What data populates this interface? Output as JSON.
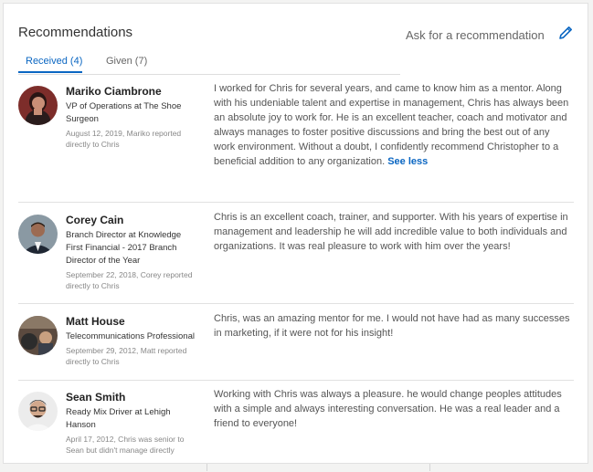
{
  "section": {
    "title": "Recommendations",
    "ask_label": "Ask for a recommendation",
    "edit_icon": "pencil-icon",
    "accent_color": "#0a66c2"
  },
  "tabs": [
    {
      "label": "Received (4)",
      "active": true
    },
    {
      "label": "Given (7)",
      "active": false
    }
  ],
  "recommendations": [
    {
      "name": "Mariko Ciambrone",
      "title": "VP of Operations at The Shoe Surgeon",
      "meta": "August 12, 2019, Mariko reported directly to Chris",
      "text": "I worked for Chris for several years, and came to know him as a mentor. Along with his undeniable talent and expertise in management, Chris has always been an absolute joy to work for. He is an excellent teacher, coach and motivator and always manages to foster positive discussions and bring the best out of any work environment. Without a doubt, I confidently recommend Christopher to a beneficial addition to any organization.",
      "see_less": "See less"
    },
    {
      "name": "Corey Cain",
      "title": "Branch Director at Knowledge First Financial - 2017 Branch Director of the Year",
      "meta": "September 22, 2018, Corey reported directly to Chris",
      "text": "Chris is an excellent coach, trainer, and supporter. With his years of expertise in management and leadership he will add incredible value to both individuals and organizations. It was real pleasure to work with him over the years!"
    },
    {
      "name": "Matt House",
      "title": "Telecommunications Professional",
      "meta": "September 29, 2012, Matt reported directly to Chris",
      "text": "Chris, was an amazing mentor for me. I would not have had as many successes in marketing, if it were not for his insight!"
    },
    {
      "name": "Sean Smith",
      "title": "Ready Mix Driver at Lehigh Hanson",
      "meta": "April 17, 2012, Chris was senior to Sean but didn't manage directly",
      "text": "Working with Chris was always a pleasure. he would change peoples attitudes with a simple and always interesting conversation. He was a real leader and a friend to everyone!"
    }
  ]
}
